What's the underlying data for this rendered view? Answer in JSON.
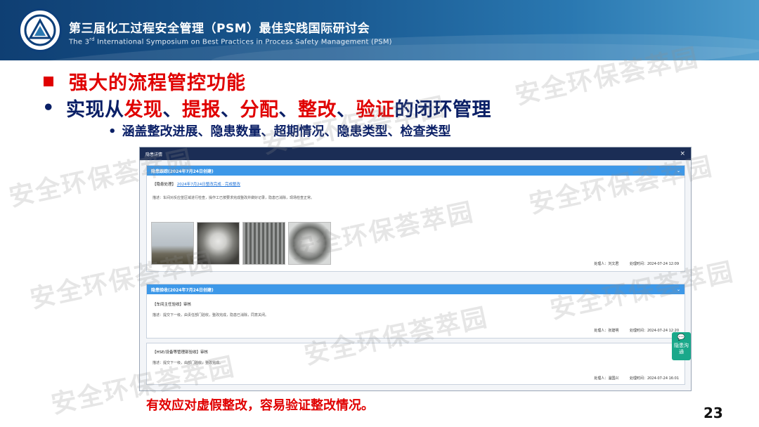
{
  "header": {
    "title": "第三届化工过程安全管理（PSM）最佳实践国际研讨会",
    "subtitle_pre": "The 3",
    "subtitle_sup": "rd",
    "subtitle_post": " International Symposium on Best Practices in Process Safety Management (PSM)"
  },
  "slide": {
    "heading": "强大的流程管控功能",
    "bullet_prefix": "实现从",
    "bullet_terms": [
      "发现",
      "提报",
      "分配",
      "整改",
      "验证"
    ],
    "bullet_sep": "、",
    "bullet_suffix": "的闭环管理",
    "sub_bullet": "涵盖整改进展、隐患数量、超期情况、隐患类型、检查类型",
    "summary": "有效应对虚假整改，容易验证整改情况。",
    "page_number": "23",
    "watermark": "安全环保荟萃园"
  },
  "dialog": {
    "title": "隐患详情",
    "close": "×",
    "card1": {
      "header": "隐患跟踪(2024年7月24日创建)",
      "sub_label": "【隐患处理】",
      "sub_link": "2024年7月24日整改完成 · 完成整改",
      "desc": "描述：车间对反应釜区域进行检查，操作工已按要求完成整改并做好记录，隐患已消除，现场检查正常。",
      "handler_label": "处理人：",
      "handler": "刘文君",
      "time_label": "处理时间：",
      "time": "2024-07-24 12:09"
    },
    "card2": {
      "header": "隐患验收(2024年7月24日创建)",
      "sub_label": "【车间主任验收】审核",
      "desc": "描述：提交下一级，由责任部门验收，整改完成，隐患已消除，同意关闭。",
      "handler_label": "处理人：",
      "handler": "张建明",
      "time_label": "处理时间：",
      "time": "2024-07-24 12:20"
    },
    "card3": {
      "sub_label": "【HSE/设备等管理部验收】审核",
      "desc": "描述：提交下一级，由部门验收，整改完成。",
      "handler_label": "处理人：",
      "handler": "温国兴",
      "time_label": "处理时间：",
      "time": "2024-07-24 16:01"
    },
    "side_button": "隐患沟通"
  },
  "colors": {
    "accent_red": "#e00000",
    "navy": "#0a1f66",
    "card_header": "#3d98e8",
    "dialog_bar": "#1b2d55",
    "side_button": "#1aa88a"
  }
}
